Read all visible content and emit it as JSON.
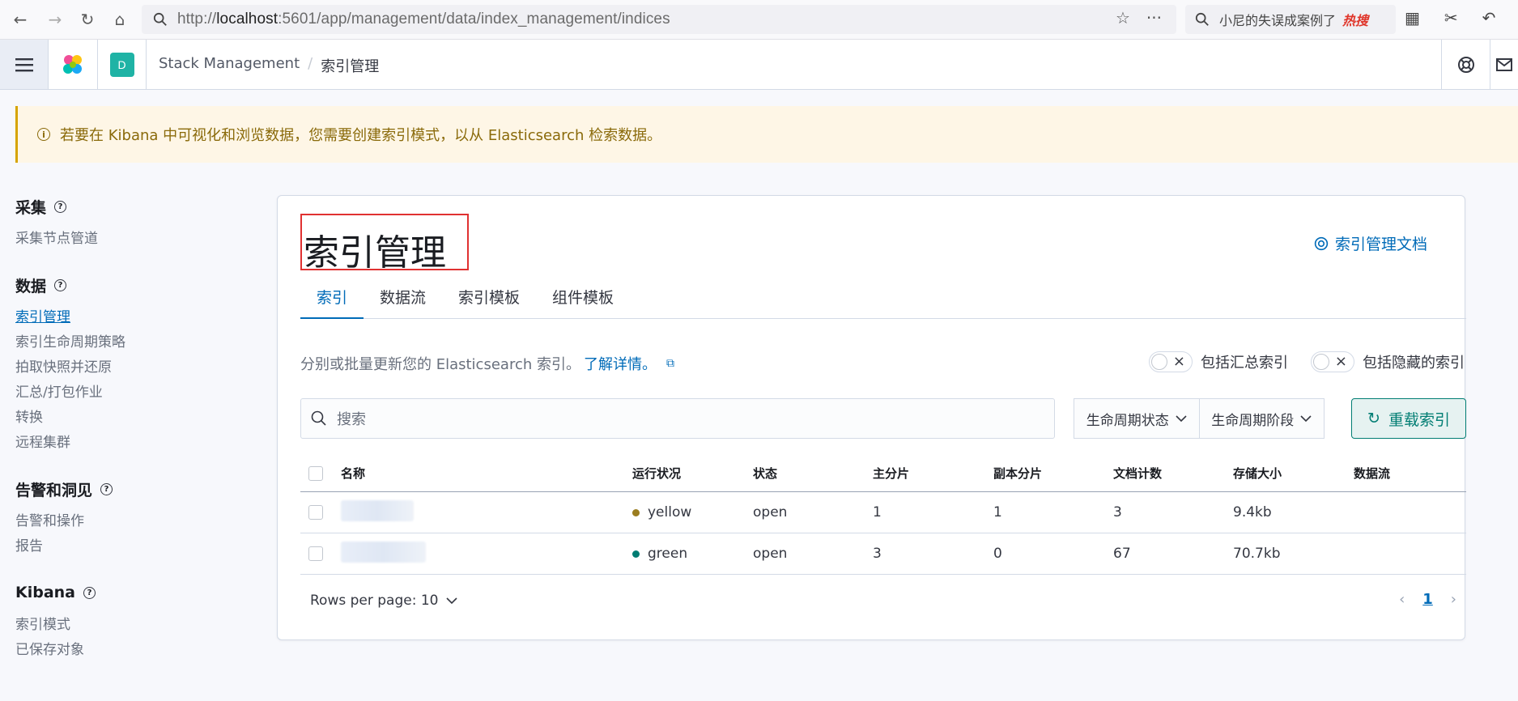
{
  "browser": {
    "url_prefix": "http://",
    "url_host": "localhost",
    "url_rest": ":5601/app/management/data/index_management/indices",
    "search_text": "小尼的失误成案例了",
    "search_hot": "热搜"
  },
  "header": {
    "space_initial": "D",
    "breadcrumbs": [
      "Stack Management",
      "索引管理"
    ]
  },
  "callout": {
    "text": "若要在 Kibana 中可视化和浏览数据，您需要创建索引模式，以从 Elasticsearch 检索数据。"
  },
  "sidebar": {
    "sections": [
      {
        "title": "采集",
        "items": [
          "采集节点管道"
        ]
      },
      {
        "title": "数据",
        "items": [
          "索引管理",
          "索引生命周期策略",
          "拍取快照并还原",
          "汇总/打包作业",
          "转换",
          "远程集群"
        ]
      },
      {
        "title": "告警和洞见",
        "items": [
          "告警和操作",
          "报告"
        ]
      },
      {
        "title": "Kibana",
        "items": [
          "索引模式",
          "已保存对象"
        ]
      }
    ]
  },
  "main": {
    "title": "索引管理",
    "doc_link": "索引管理文档",
    "tabs": [
      "索引",
      "数据流",
      "索引模板",
      "组件模板"
    ],
    "description": "分别或批量更新您的 Elasticsearch 索引。",
    "learn_more": "了解详情。",
    "toggle_rollup": "包括汇总索引",
    "toggle_hidden": "包括隐藏的索引",
    "search_placeholder": "搜索",
    "filter_lifecycle_status": "生命周期状态",
    "filter_lifecycle_phase": "生命周期阶段",
    "reload_button": "重载索引",
    "columns": [
      "名称",
      "运行状况",
      "状态",
      "主分片",
      "副本分片",
      "文档计数",
      "存储大小",
      "数据流"
    ],
    "rows": [
      {
        "health": "yellow",
        "health_color": "#9b7d1f",
        "status": "open",
        "primary": "1",
        "replica": "1",
        "docs": "3",
        "size": "9.4kb",
        "data_stream": ""
      },
      {
        "health": "green",
        "health_color": "#017d73",
        "status": "open",
        "primary": "3",
        "replica": "0",
        "docs": "67",
        "size": "70.7kb",
        "data_stream": ""
      }
    ],
    "rows_per_page": "Rows per page: 10",
    "current_page": "1"
  }
}
